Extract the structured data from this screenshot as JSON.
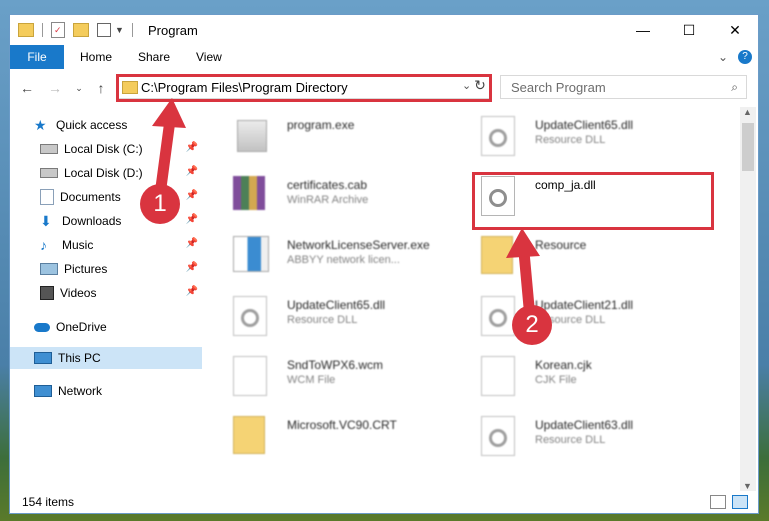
{
  "window": {
    "title": "Program",
    "minimize_glyph": "—",
    "maximize_glyph": "☐",
    "close_glyph": "✕"
  },
  "ribbon": {
    "file": "File",
    "home": "Home",
    "share": "Share",
    "view": "View",
    "help_glyph": "?"
  },
  "nav": {
    "address": "C:\\Program Files\\Program Directory",
    "search_placeholder": "Search Program"
  },
  "sidebar": {
    "items": [
      {
        "label": "Quick access",
        "icon": "star-icon"
      },
      {
        "label": "Local Disk (C:)",
        "icon": "drive-icon"
      },
      {
        "label": "Local Disk (D:)",
        "icon": "drive-icon"
      },
      {
        "label": "Documents",
        "icon": "documents-icon"
      },
      {
        "label": "Downloads",
        "icon": "download-icon"
      },
      {
        "label": "Music",
        "icon": "music-icon"
      },
      {
        "label": "Pictures",
        "icon": "pictures-icon"
      },
      {
        "label": "Videos",
        "icon": "videos-icon"
      },
      {
        "label": "OneDrive",
        "icon": "cloud-icon"
      },
      {
        "label": "This PC",
        "icon": "computer-icon"
      },
      {
        "label": "Network",
        "icon": "network-icon"
      }
    ]
  },
  "files": [
    {
      "name": "program.exe",
      "type": ""
    },
    {
      "name": "UpdateClient65.dll",
      "type": "Resource DLL"
    },
    {
      "name": "certificates.cab",
      "type": "WinRAR Archive"
    },
    {
      "name": "comp_ja.dll",
      "type": ""
    },
    {
      "name": "NetworkLicenseServer.exe",
      "type": "ABBYY network licen..."
    },
    {
      "name": "Resource",
      "type": ""
    },
    {
      "name": "UpdateClient65.dll",
      "type": "Resource DLL"
    },
    {
      "name": "UpdateClient21.dll",
      "type": "Resource DLL"
    },
    {
      "name": "SndToWPX6.wcm",
      "type": "WCM File"
    },
    {
      "name": "Korean.cjk",
      "type": "CJK File"
    },
    {
      "name": "Microsoft.VC90.CRT",
      "type": ""
    },
    {
      "name": "UpdateClient63.dll",
      "type": "Resource DLL"
    }
  ],
  "status": {
    "count": "154 items"
  },
  "annotations": {
    "step1": "1",
    "step2": "2",
    "color": "#d9343f"
  },
  "colors": {
    "accent": "#1979ca",
    "selected": "#cce4f7",
    "annotation": "#d9343f"
  }
}
